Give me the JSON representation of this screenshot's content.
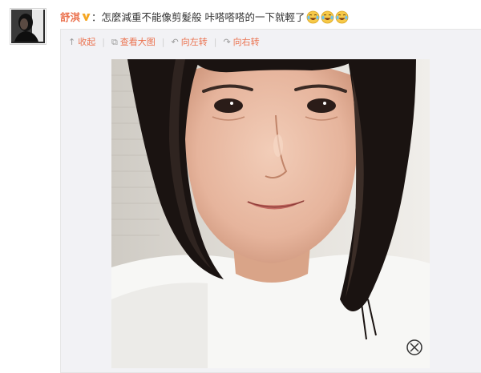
{
  "post": {
    "author": "舒淇",
    "colon": "：",
    "text": "怎麼減重不能像剪髮般 咔嗒嗒嗒的一下就輕了",
    "emoji_count": 3,
    "verified_badge_color": "#f5a623",
    "author_color": "#eb7350"
  },
  "toolbar": {
    "collect": {
      "icon": "collapse-up-icon",
      "label": "收起"
    },
    "view_large": {
      "icon": "zoom-icon",
      "label": "查看大图"
    },
    "rotate_left": {
      "icon": "rotate-left-icon",
      "label": "向左转"
    },
    "rotate_right": {
      "icon": "rotate-right-icon",
      "label": "向右转"
    }
  },
  "colors": {
    "panel_bg": "#f2f2f5",
    "link": "#eb7350"
  }
}
